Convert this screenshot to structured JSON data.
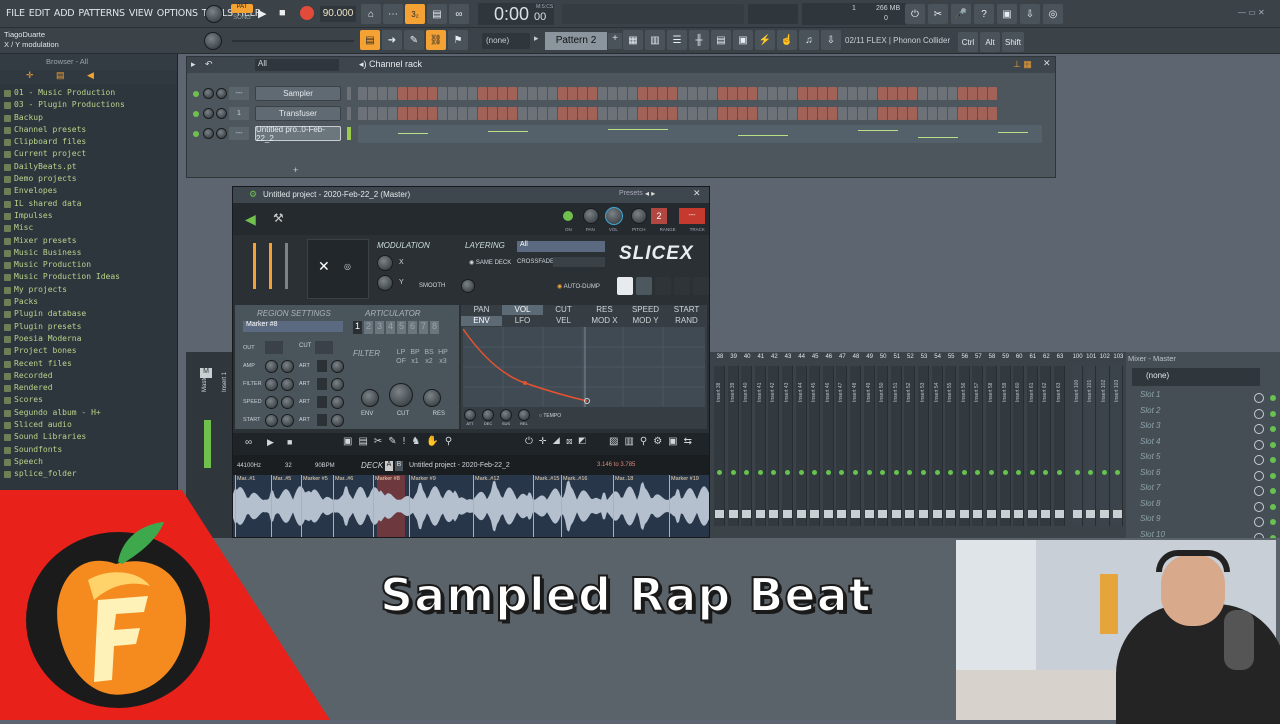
{
  "menu": [
    "FILE",
    "EDIT",
    "ADD",
    "PATTERNS",
    "VIEW",
    "OPTIONS",
    "TOOLS",
    "HELP"
  ],
  "transport": {
    "pat": "PAT",
    "song": "SONG",
    "tempo": "90.000",
    "time": "0:00",
    "time_small": "00",
    "mcs": "M:S:CS",
    "cpu_num": "1",
    "mem": "266 MB",
    "mem2": "0"
  },
  "hint": {
    "user": "TiagoDuarte",
    "text": "X / Y modulation"
  },
  "toolbar": {
    "snap": "(none)",
    "pattern": "Pattern 2",
    "plugin": "02/11  FLEX | Phonon Collider",
    "keys": [
      "Ctrl",
      "Alt",
      "Shift"
    ]
  },
  "browser": {
    "title": "Browser - All",
    "items": [
      "01 - Music Production",
      "03 - Plugin Productions",
      "Backup",
      "Channel presets",
      "Clipboard files",
      "Current project",
      "DailyBeats.pt",
      "Demo projects",
      "Envelopes",
      "IL shared data",
      "Impulses",
      "Misc",
      "Mixer presets",
      "Music Business",
      "Music Production",
      "Music Production Ideas",
      "My projects",
      "Packs",
      "Plugin database",
      "Plugin presets",
      "Poesia Moderna",
      "Project bones",
      "Recent files",
      "Recorded",
      "Rendered",
      "Scores",
      "Segundo album - H+",
      "Sliced audio",
      "Sound Libraries",
      "Soundfonts",
      "Speech",
      "splice_folder"
    ]
  },
  "rack": {
    "title": "Channel rack",
    "filter": "All",
    "channels": [
      {
        "num": "---",
        "name": "Sampler"
      },
      {
        "num": "1",
        "name": "Transfuser"
      },
      {
        "num": "---",
        "name": "Untitled pro..0-Feb-22_2"
      }
    ]
  },
  "slicex": {
    "title": "Untitled project - 2020-Feb-22_2 (Master)",
    "presets": "Presets",
    "logo": "SLICEX",
    "modulation": "MODULATION",
    "x": "X",
    "y": "Y",
    "smooth": "SMOOTH",
    "layering": "LAYERING",
    "layer_val": "All",
    "same_deck": "SAME DECK",
    "crossfade": "CROSSFADE",
    "auto_dump": "AUTO-DUMP",
    "knob_labels": [
      "ON",
      "PAN",
      "VOL",
      "PITCH",
      "RANGE",
      "TRACK"
    ],
    "pitch_range": "2",
    "region": "REGION SETTINGS",
    "marker": "Marker #8",
    "articulator": "ARTICULATOR",
    "art_nums": [
      "1",
      "2",
      "3",
      "4",
      "5",
      "6",
      "7",
      "8"
    ],
    "region_rows": [
      "OUT",
      "AMP",
      "FILTER",
      "SPEED",
      "START"
    ],
    "cut": "CUT",
    "art": "ART",
    "filter": "FILTER",
    "filter_types": [
      "LP",
      "BP",
      "BS",
      "HP",
      "OF",
      "x1",
      "x2",
      "x3"
    ],
    "filter_knobs": [
      "ENV",
      "CUT",
      "RES"
    ],
    "env_tabs_top": [
      "PAN",
      "VOL",
      "CUT",
      "RES",
      "SPEED",
      "START"
    ],
    "env_tabs_bot": [
      "ENV",
      "LFO",
      "VEL",
      "MOD X",
      "MOD Y",
      "RAND"
    ],
    "env_knobs": [
      "ATT",
      "DEC",
      "SUS",
      "REL"
    ],
    "tempo": "TEMPO",
    "deck_label": "DECK",
    "deck_ab": [
      "A",
      "B"
    ],
    "samplerate": "44100Hz",
    "bits": "32",
    "bpm": "90BPM",
    "file": "Untitled project - 2020-Feb-22_2",
    "sel_range": "3.146 to 3.785",
    "markers": [
      "Mar..#1",
      "Mar..#5",
      "Marker #5",
      "Mar..#6",
      "Marker #8",
      "Marker #9",
      "Mark..#12",
      "Mark..#15",
      "Mark..#16",
      "Mar..18",
      "Marker #19"
    ]
  },
  "mixer": {
    "title": "Mixer - Master",
    "slot_header": "(none)",
    "slots": [
      "Slot 1",
      "Slot 2",
      "Slot 3",
      "Slot 4",
      "Slot 5",
      "Slot 6",
      "Slot 7",
      "Slot 8",
      "Slot 9",
      "Slot 10"
    ],
    "inserts": [
      "38",
      "39",
      "40",
      "41",
      "42",
      "43",
      "44",
      "45",
      "46",
      "47",
      "48",
      "49",
      "50",
      "51",
      "52",
      "53",
      "54",
      "55",
      "56",
      "57",
      "58",
      "59",
      "60",
      "61",
      "62",
      "63",
      "100",
      "101",
      "102",
      "103"
    ],
    "insert_labels": [
      "Insert 38",
      "Insert 39",
      "Insert 40",
      "Insert 41",
      "Insert 42",
      "Insert 43",
      "Insert 44",
      "Insert 45",
      "Insert 46",
      "Insert 47",
      "Insert 48",
      "Insert 49",
      "Insert 50",
      "Insert 51",
      "Insert 52",
      "Insert 53",
      "Insert 54",
      "Insert 55",
      "Insert 56",
      "Insert 57",
      "Insert 58",
      "Insert 59",
      "Insert 60",
      "Insert 61",
      "Insert 62",
      "Insert 63",
      "Insert 100",
      "Insert 101",
      "Insert 102",
      "Insert 103"
    ],
    "left_labels": [
      "M",
      "Master",
      "Insert 1"
    ]
  },
  "banner": {
    "title": "Sampled Rap Beat"
  },
  "colors": {
    "accent": "#f4a233",
    "red": "#e8211a",
    "led": "#67c24f"
  }
}
